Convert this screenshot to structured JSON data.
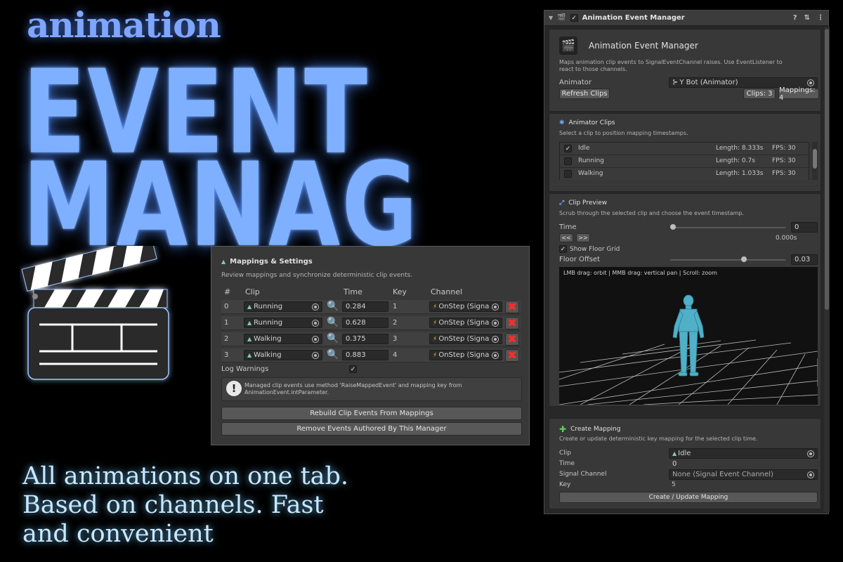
{
  "promo": {
    "subtitle": "animation",
    "title_line1": "EVENT",
    "title_line2": "MANAG",
    "tagline": [
      "All animations on one tab.",
      "Based on channels. Fast",
      "and convenient"
    ]
  },
  "colors": {
    "accent_blue": "#7fb0ff",
    "panel_bg": "#383838",
    "delete_red": "#ff2b2b",
    "model_teal": "#4fb0c8"
  },
  "inspector": {
    "component_title": "Animation Event Manager",
    "header": {
      "title": "Animation Event Manager",
      "description": "Maps animation clip events to SignalEventChannel raises. Use EventListener to react to those channels.",
      "animator_label": "Animator",
      "animator_value": "Y Bot (Animator)",
      "refresh_label": "Refresh Clips",
      "clips_badge": "Clips: 3",
      "mappings_badge": "Mappings: 4"
    },
    "animator_clips": {
      "title": "Animator Clips",
      "description": "Select a clip to position mapping timestamps.",
      "clips": [
        {
          "name": "Idle",
          "length": "Length: 8.333s",
          "fps": "FPS: 30",
          "checked": true
        },
        {
          "name": "Running",
          "length": "Length: 0.7s",
          "fps": "FPS: 30",
          "checked": false
        },
        {
          "name": "Walking",
          "length": "Length: 1.033s",
          "fps": "FPS: 30",
          "checked": false
        }
      ]
    },
    "clip_preview": {
      "title": "Clip Preview",
      "description": "Scrub through the selected clip and choose the event timestamp.",
      "time_label": "Time",
      "time_value": "0",
      "time_slider": 0,
      "prev_label": "<<",
      "next_label": ">>",
      "time_seconds": "0.000s",
      "show_floor_label": "Show Floor Grid",
      "show_floor_checked": true,
      "floor_offset_label": "Floor Offset",
      "floor_offset_value": "0.03",
      "floor_offset_slider": 0.65,
      "viewport_hint": "LMB drag: orbit | MMB drag: vertical pan | Scroll: zoom"
    },
    "create_mapping": {
      "title": "Create Mapping",
      "description": "Create or update deterministic key mapping for the selected clip time.",
      "clip_label": "Clip",
      "clip_value": "Idle",
      "time_label": "Time",
      "time_value": "0",
      "channel_label": "Signal Channel",
      "channel_value": "None (Signal Event Channel)",
      "key_label": "Key",
      "key_value": "5",
      "button_label": "Create / Update Mapping"
    }
  },
  "mappings": {
    "title": "Mappings & Settings",
    "description": "Review mappings and synchronize deterministic clip events.",
    "columns": {
      "index": "#",
      "clip": "Clip",
      "time": "Time",
      "key": "Key",
      "channel": "Channel"
    },
    "rows": [
      {
        "index": "0",
        "clip": "Running",
        "time": "0.284",
        "key": "1",
        "channel": "OnStep (Signa"
      },
      {
        "index": "1",
        "clip": "Running",
        "time": "0.628",
        "key": "2",
        "channel": "OnStep (Signa"
      },
      {
        "index": "2",
        "clip": "Walking",
        "time": "0.375",
        "key": "3",
        "channel": "OnStep (Signa"
      },
      {
        "index": "3",
        "clip": "Walking",
        "time": "0.883",
        "key": "4",
        "channel": "OnStep (Signa"
      }
    ],
    "log_warnings_label": "Log Warnings",
    "log_warnings_checked": true,
    "info_text": "Managed clip events use method 'RaiseMappedEvent' and mapping key from AnimationEvent.intParameter.",
    "rebuild_label": "Rebuild Clip Events From Mappings",
    "remove_label": "Remove Events Authored By This Manager"
  }
}
